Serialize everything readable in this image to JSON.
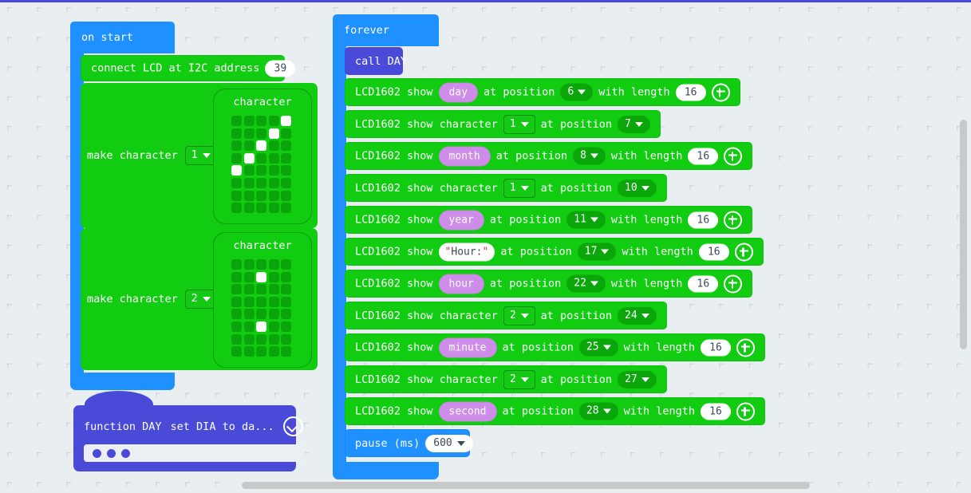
{
  "app": {
    "name": "MakeCode Blocks Editor"
  },
  "workspace": {
    "background_color": "#e9eef1",
    "grid_color": "#a0acb4"
  },
  "on_start": {
    "label": "on start",
    "color": "#1e90ff",
    "connect_lcd": {
      "label": "connect LCD at I2C address",
      "value": "39",
      "color": "#12cc12"
    },
    "make_character_1": {
      "label": "make character",
      "index": "1",
      "grid_caption": "character",
      "grid_cols": 5,
      "grid_rows": 8,
      "lit_cells": [
        [
          0,
          4
        ],
        [
          1,
          3
        ],
        [
          2,
          2
        ],
        [
          3,
          1
        ],
        [
          4,
          0
        ]
      ]
    },
    "make_character_2": {
      "label": "make character",
      "index": "2",
      "grid_caption": "character",
      "grid_cols": 5,
      "grid_rows": 8,
      "lit_cells": [
        [
          1,
          2
        ],
        [
          5,
          2
        ]
      ]
    }
  },
  "function_day": {
    "label": "function DAY",
    "preview": "set DIA to da...",
    "collapse_icon": "chevron-down-circle-icon",
    "color": "#4a4ad8"
  },
  "forever": {
    "label": "forever",
    "color": "#1e90ff",
    "call": {
      "label": "call DAY",
      "color": "#4a4ad8"
    },
    "rows": [
      {
        "kind": "var",
        "prefix": "LCD1602 show",
        "value": "day",
        "pos_label": "at position",
        "pos": "6",
        "len_label": "with length",
        "len": "16",
        "plus": "add-icon"
      },
      {
        "kind": "char",
        "prefix": "LCD1602 show character",
        "value": "1",
        "pos_label": "at position",
        "pos": "7"
      },
      {
        "kind": "var",
        "prefix": "LCD1602 show",
        "value": "month",
        "pos_label": "at position",
        "pos": "8",
        "len_label": "with length",
        "len": "16",
        "plus": "add-icon"
      },
      {
        "kind": "char",
        "prefix": "LCD1602 show character",
        "value": "1",
        "pos_label": "at position",
        "pos": "10"
      },
      {
        "kind": "var",
        "prefix": "LCD1602 show",
        "value": "year",
        "pos_label": "at position",
        "pos": "11",
        "len_label": "with length",
        "len": "16",
        "plus": "add-icon"
      },
      {
        "kind": "str",
        "prefix": "LCD1602 show",
        "value": "Hour:",
        "pos_label": "at position",
        "pos": "17",
        "len_label": "with length",
        "len": "16",
        "plus": "add-icon"
      },
      {
        "kind": "var",
        "prefix": "LCD1602 show",
        "value": "hour",
        "pos_label": "at position",
        "pos": "22",
        "len_label": "with length",
        "len": "16",
        "plus": "add-icon"
      },
      {
        "kind": "char",
        "prefix": "LCD1602 show character",
        "value": "2",
        "pos_label": "at position",
        "pos": "24"
      },
      {
        "kind": "var",
        "prefix": "LCD1602 show",
        "value": "minute",
        "pos_label": "at position",
        "pos": "25",
        "len_label": "with length",
        "len": "16",
        "plus": "add-icon"
      },
      {
        "kind": "char",
        "prefix": "LCD1602 show character",
        "value": "2",
        "pos_label": "at position",
        "pos": "27"
      },
      {
        "kind": "var",
        "prefix": "LCD1602 show",
        "value": "second",
        "pos_label": "at position",
        "pos": "28",
        "len_label": "with length",
        "len": "16",
        "plus": "add-icon"
      }
    ],
    "pause": {
      "label": "pause (ms)",
      "value": "600",
      "color": "#1e90ff"
    }
  },
  "scrollbars": {
    "vertical": "vertical-scrollbar",
    "horizontal": "horizontal-scrollbar"
  }
}
